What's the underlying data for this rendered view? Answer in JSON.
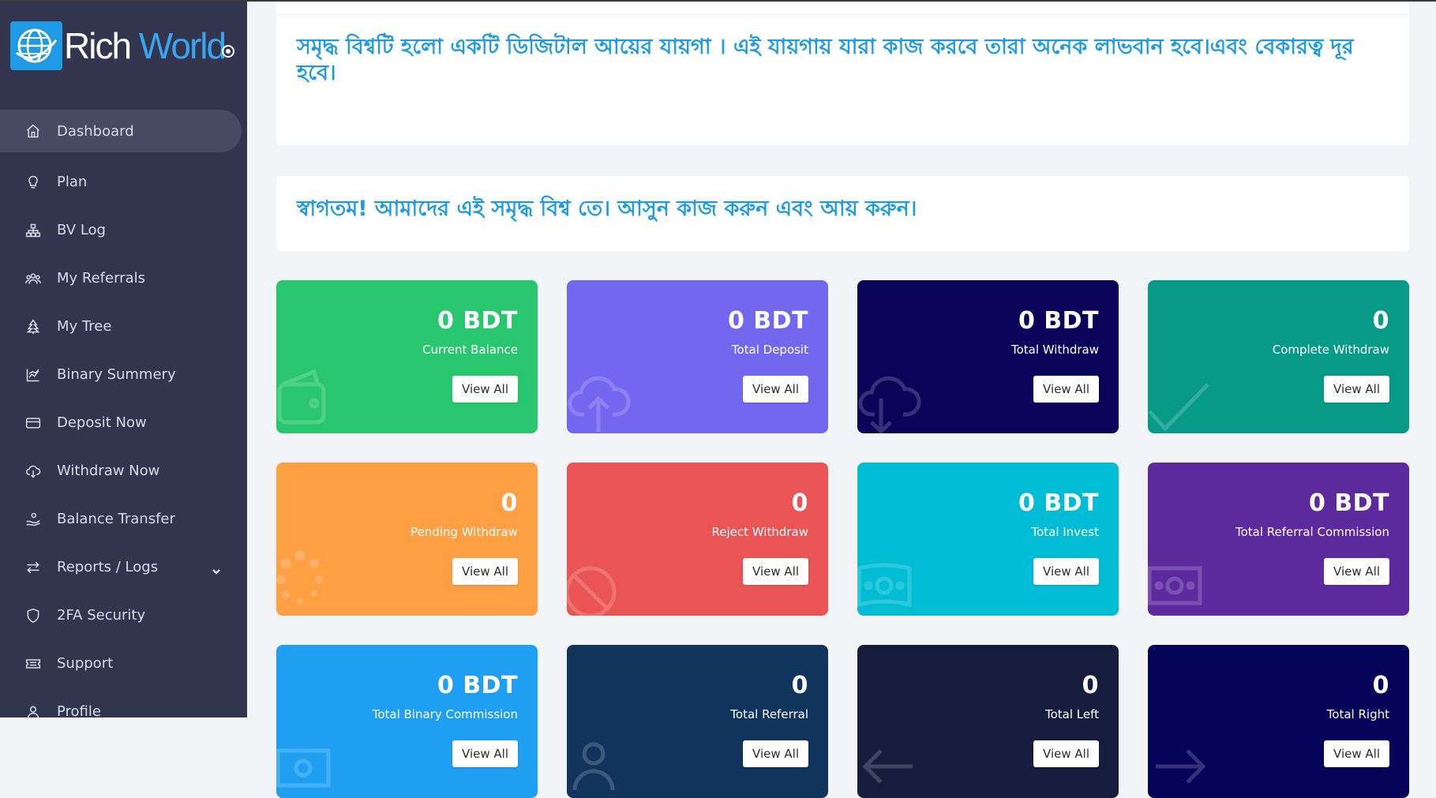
{
  "brand": {
    "name_part1": "Rich",
    "name_part2": " World"
  },
  "sidebar": {
    "items": [
      {
        "label": "Dashboard",
        "icon": "home-icon"
      },
      {
        "label": "Plan",
        "icon": "lightbulb-icon"
      },
      {
        "label": "BV Log",
        "icon": "hierarchy-icon"
      },
      {
        "label": "My Referrals",
        "icon": "users-icon"
      },
      {
        "label": "My Tree",
        "icon": "tree-icon"
      },
      {
        "label": "Binary Summery",
        "icon": "chart-icon"
      },
      {
        "label": "Deposit Now",
        "icon": "credit-card-icon"
      },
      {
        "label": "Withdraw Now",
        "icon": "cloud-download-icon"
      },
      {
        "label": "Balance Transfer",
        "icon": "hand-coin-icon"
      },
      {
        "label": "Reports / Logs",
        "icon": "arrows-swap-icon"
      },
      {
        "label": "2FA Security",
        "icon": "shield-icon"
      },
      {
        "label": "Support",
        "icon": "ticket-icon"
      },
      {
        "label": "Profile",
        "icon": "user-icon"
      }
    ]
  },
  "notice": {
    "headline": "সমৃদ্ধ বিশ্বটি হলো একটি ডিজিটাল আয়ের যায়গা । এই যায়গায়  যারা কাজ করবে তারা অনেক লাভবান হবে।এবং বেকারত্ব দূর হবে।",
    "welcome": "স্বাগতম! আমাদের এই সমৃদ্ধ বিশ্ব তে। আসুন কাজ করুন এবং আয় করুন।"
  },
  "cards": [
    {
      "value": "0 BDT",
      "label": "Current Balance",
      "button": "View All",
      "color": "#28c76f",
      "icon": "wallet-icon"
    },
    {
      "value": "0 BDT",
      "label": "Total Deposit",
      "button": "View All",
      "color": "#7367f0",
      "icon": "cloud-upload-icon"
    },
    {
      "value": "0 BDT",
      "label": "Total Withdraw",
      "button": "View All",
      "color": "#0a0359",
      "icon": "cloud-download-icon"
    },
    {
      "value": "0",
      "label": "Complete Withdraw",
      "button": "View All",
      "color": "#079b87",
      "icon": "check-icon"
    },
    {
      "value": "0",
      "label": "Pending Withdraw",
      "button": "View All",
      "color": "#ff9f43",
      "icon": "spinner-icon"
    },
    {
      "value": "0",
      "label": "Reject Withdraw",
      "button": "View All",
      "color": "#ea5455",
      "icon": "ban-icon"
    },
    {
      "value": "0 BDT",
      "label": "Total Invest",
      "button": "View All",
      "color": "#00bcd4",
      "icon": "money-icon"
    },
    {
      "value": "0 BDT",
      "label": "Total Referral Commission",
      "button": "View All",
      "color": "#5d2a9d",
      "icon": "money-icon"
    },
    {
      "value": "0 BDT",
      "label": "Total Binary Commission",
      "button": "View All",
      "color": "#1e9ff2",
      "icon": "money-icon"
    },
    {
      "value": "0",
      "label": "Total Referral",
      "button": "View All",
      "color": "#11345c",
      "icon": "users-icon"
    },
    {
      "value": "0",
      "label": "Total Left",
      "button": "View All",
      "color": "#151c3d",
      "icon": "arrow-left-icon"
    },
    {
      "value": "0",
      "label": "Total Right",
      "button": "View All",
      "color": "#06035a",
      "icon": "arrow-right-icon"
    }
  ]
}
